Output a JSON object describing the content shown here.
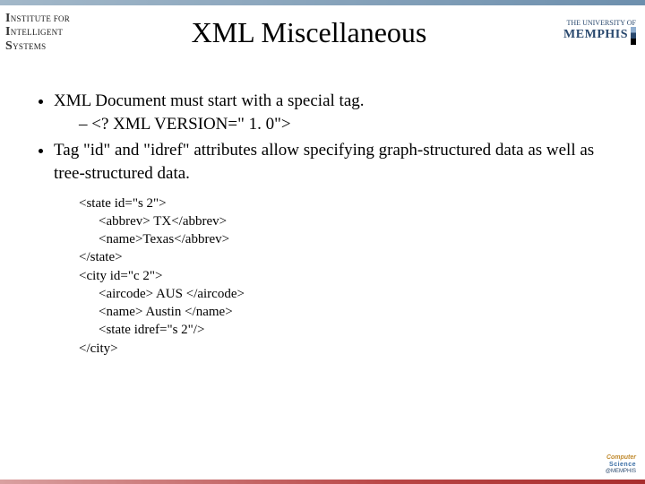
{
  "header": {
    "left_logo": {
      "line1": "NSTITUTE FOR",
      "line2": "NTELLIGENT",
      "line3": "YSTEMS"
    },
    "title": "XML Miscellaneous",
    "right_logo": {
      "line1": "THE UNIVERSITY OF",
      "line2": "MEMPHIS"
    }
  },
  "bullets": {
    "b1": "XML Document must start with a special tag.",
    "b1_sub": "<? XML VERSION=\" 1. 0\">",
    "b2": "Tag \"id\" and \"idref\" attributes allow specifying graph-structured data as well as tree-structured data."
  },
  "code": {
    "l1": "<state id=\"s 2\">",
    "l2": "<abbrev> TX</abbrev>",
    "l3": "<name>Texas</abbrev>",
    "l4": "</state>",
    "l5": "<city id=\"c 2\">",
    "l6": "<aircode> AUS </aircode>",
    "l7": "<name> Austin </name>",
    "l8": "<state idref=\"s 2\"/>",
    "l9": "</city>"
  },
  "footer_logo": {
    "line1": "Computer",
    "line2": "Science",
    "line3": "@MEMPHIS"
  }
}
